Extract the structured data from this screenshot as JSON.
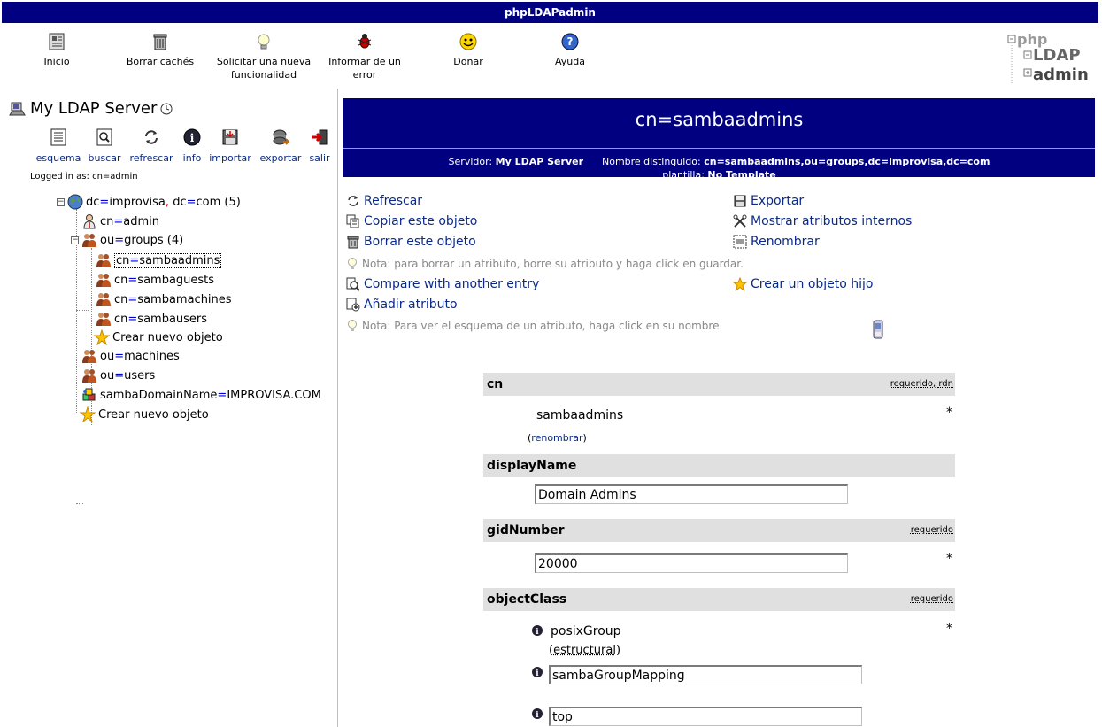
{
  "app": {
    "title": "phpLDAPadmin"
  },
  "toolbar": {
    "inicio": "Inicio",
    "borrar": "Borrar cachés",
    "solicitar_line1": "Solicitar una nueva",
    "solicitar_line2": "funcionalidad",
    "informar_line1": "Informar de un",
    "informar_line2": "error",
    "donar": "Donar",
    "ayuda": "Ayuda"
  },
  "logo": {
    "line1": "php",
    "line2": "LDAP",
    "line3": "admin"
  },
  "server": {
    "name": "My LDAP Server",
    "logged_in": "Logged in as: cn=admin",
    "tools": [
      "esquema",
      "buscar",
      "refrescar",
      "info",
      "importar",
      "exportar",
      "salir"
    ]
  },
  "tree": {
    "root": {
      "a": "dc",
      "av": "improvisa",
      "b": "dc",
      "bv": "com",
      "count": "(5)"
    },
    "admin": {
      "a": "cn",
      "v": "admin"
    },
    "groups": {
      "a": "ou",
      "v": "groups",
      "count": "(4)"
    },
    "g1": {
      "a": "cn",
      "v": "sambaadmins"
    },
    "g2": {
      "a": "cn",
      "v": "sambaguests"
    },
    "g3": {
      "a": "cn",
      "v": "sambamachines"
    },
    "g4": {
      "a": "cn",
      "v": "sambausers"
    },
    "create_child": "Crear nuevo objeto",
    "machines": {
      "a": "ou",
      "v": "machines"
    },
    "users": {
      "a": "ou",
      "v": "users"
    },
    "domain": {
      "a": "sambaDomainName",
      "v": "IMPROVISA.COM"
    },
    "create_root": "Crear nuevo objeto"
  },
  "entry": {
    "title": "cn=sambaadmins",
    "server_label": "Servidor:",
    "server_value": "My LDAP Server",
    "dn_label": "Nombre distinguido:",
    "dn_value": "cn=sambaadmins,ou=groups,dc=improvisa,dc=com",
    "template_label": "plantilla:",
    "template_value": "No Template"
  },
  "actions": {
    "refrescar": "Refrescar",
    "copiar": "Copiar este objeto",
    "borrar": "Borrar este objeto",
    "nota_borrar": "Nota: para borrar un atributo, borre su atributo y haga click en guardar.",
    "compare": "Compare with another entry",
    "anadir": "Añadir atributo",
    "nota_esquema": "Nota: Para ver el esquema de un atributo, haga click en su nombre.",
    "exportar": "Exportar",
    "mostrar": "Mostrar atributos internos",
    "renombrar": "Renombrar",
    "crear_hijo": "Crear un objeto hijo"
  },
  "attributes": {
    "cn": {
      "name": "cn",
      "req1": "requerido",
      "sep": ",",
      "req2": "rdn",
      "value": "sambaadmins",
      "rename_open": "(",
      "rename": "renombrar",
      "rename_close": ")",
      "star": "*"
    },
    "displayName": {
      "name": "displayName",
      "value": "Domain Admins"
    },
    "gidNumber": {
      "name": "gidNumber",
      "req": "requerido",
      "value": "20000",
      "star": "*"
    },
    "objectClass": {
      "name": "objectClass",
      "req": "requerido",
      "star": "*",
      "v1": "posixGroup",
      "v1_open": "(",
      "v1_note": "estructural",
      "v1_close": ")",
      "v2": "sambaGroupMapping",
      "v3": "top"
    }
  }
}
